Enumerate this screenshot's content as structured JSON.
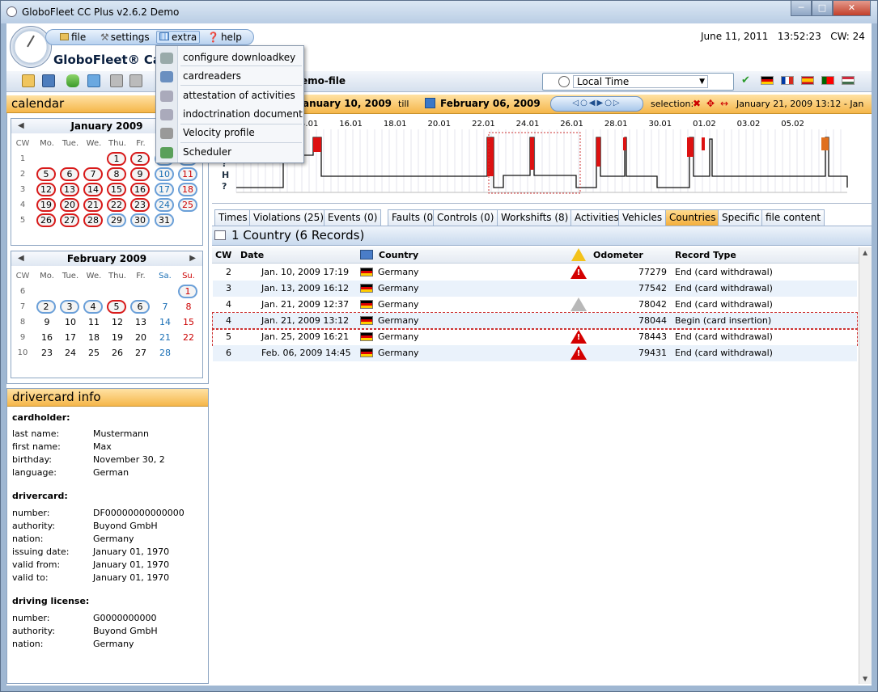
{
  "window": {
    "title": "GloboFleet CC Plus v2.6.2 Demo"
  },
  "header": {
    "brand": "GloboFleet® Card",
    "date": "June 11, 2011",
    "time": "13:52:23",
    "cw": "CW: 24",
    "file_title": "emo-file"
  },
  "menu": {
    "file": "file",
    "settings": "settings",
    "extra": "extra",
    "help": "help"
  },
  "extra_menu": {
    "items": [
      "configure downloadkey",
      "cardreaders",
      "attestation of activities",
      "indoctrination document",
      "Velocity profile",
      "Scheduler"
    ]
  },
  "toolbar": {
    "timezone": "Local Time"
  },
  "calendar": {
    "header": "calendar",
    "weekday_headers": [
      "CW",
      "Mo.",
      "Tue.",
      "We.",
      "Thu.",
      "Fr.",
      "Sa.",
      "Su."
    ],
    "january": {
      "title": "January 2009",
      "cw": [
        "1",
        "2",
        "3",
        "4",
        "5"
      ],
      "rows": [
        [
          "",
          "",
          "",
          "1",
          "2",
          "3",
          "4"
        ],
        [
          "5",
          "6",
          "7",
          "8",
          "9",
          "10",
          "11"
        ],
        [
          "12",
          "13",
          "14",
          "15",
          "16",
          "17",
          "18"
        ],
        [
          "19",
          "20",
          "21",
          "22",
          "23",
          "24",
          "25"
        ],
        [
          "26",
          "27",
          "28",
          "29",
          "30",
          "31",
          ""
        ]
      ]
    },
    "february": {
      "title": "February 2009",
      "cw": [
        "6",
        "7",
        "8",
        "9",
        "10"
      ],
      "rows": [
        [
          "",
          "",
          "",
          "",
          "",
          "",
          "1"
        ],
        [
          "2",
          "3",
          "4",
          "5",
          "6",
          "7",
          "8"
        ],
        [
          "9",
          "10",
          "11",
          "12",
          "13",
          "14",
          "15"
        ],
        [
          "16",
          "17",
          "18",
          "19",
          "20",
          "21",
          "22"
        ],
        [
          "23",
          "24",
          "25",
          "26",
          "27",
          "28",
          ""
        ]
      ]
    }
  },
  "drivercard": {
    "header": "drivercard info",
    "cardholder_title": "cardholder:",
    "last_name_label": "last name:",
    "last_name": "Mustermann",
    "first_name_label": "first name:",
    "first_name": "Max",
    "birthday_label": "birthday:",
    "birthday": "November 30, 2",
    "language_label": "language:",
    "language": "German",
    "drivercard_title": "drivercard:",
    "number_label": "number:",
    "number": "DF00000000000000",
    "authority_label": "authority:",
    "authority": "Buyond GmbH",
    "nation_label": "nation:",
    "nation": "Germany",
    "issuing_label": "issuing date:",
    "issuing": "January 01, 1970",
    "valid_from_label": "valid from:",
    "valid_from": "January 01, 1970",
    "valid_to_label": "valid to:",
    "valid_to": "January 01, 1970",
    "license_title": "driving license:",
    "lic_number_label": "number:",
    "lic_number": "G0000000000",
    "lic_authority_label": "authority:",
    "lic_authority": "Buyond GmbH",
    "lic_nation_label": "nation:",
    "lic_nation": "Germany"
  },
  "range": {
    "from": "anuary 10, 2009",
    "till_label": "till",
    "to": "February 06, 2009",
    "selection_label": "selection:",
    "selection_value": "January 21, 2009 13:12 - Jan"
  },
  "timeline": {
    "dates": [
      "14.01",
      "16.01",
      "18.01",
      "20.01",
      "22.01",
      "24.01",
      "26.01",
      "28.01",
      "30.01",
      "01.02",
      "03.02",
      "05.02"
    ]
  },
  "tabs": [
    "Times",
    "Violations (25)",
    "Events (0)",
    "Faults (0)",
    "Controls (0)",
    "Workshifts (8)",
    "Activities",
    "Vehicles",
    "Countries",
    "Specific",
    "file content"
  ],
  "grid": {
    "title": "1 Country (6 Records)",
    "headers": {
      "cw": "CW",
      "date": "Date",
      "country": "Country",
      "odometer": "Odometer",
      "record_type": "Record Type"
    },
    "rows": [
      {
        "cw": "2",
        "date": "Jan. 10, 2009 17:19",
        "country": "Germany",
        "warn": "red",
        "odometer": "77279",
        "record_type": "End (card withdrawal)"
      },
      {
        "cw": "3",
        "date": "Jan. 13, 2009 16:12",
        "country": "Germany",
        "warn": "",
        "odometer": "77542",
        "record_type": "End (card withdrawal)"
      },
      {
        "cw": "4",
        "date": "Jan. 21, 2009 12:37",
        "country": "Germany",
        "warn": "grey",
        "odometer": "78042",
        "record_type": "End (card withdrawal)"
      },
      {
        "cw": "4",
        "date": "Jan. 21, 2009 13:12",
        "country": "Germany",
        "warn": "",
        "odometer": "78044",
        "record_type": "Begin (card insertion)"
      },
      {
        "cw": "5",
        "date": "Jan. 25, 2009 16:21",
        "country": "Germany",
        "warn": "red",
        "odometer": "78443",
        "record_type": "End (card withdrawal)"
      },
      {
        "cw": "6",
        "date": "Feb. 06, 2009 14:45",
        "country": "Germany",
        "warn": "red",
        "odometer": "79431",
        "record_type": "End (card withdrawal)"
      }
    ]
  },
  "colors": {
    "accent_orange": "#f5b64a",
    "accent_blue": "#c9daee",
    "warning_red": "#d40000"
  }
}
